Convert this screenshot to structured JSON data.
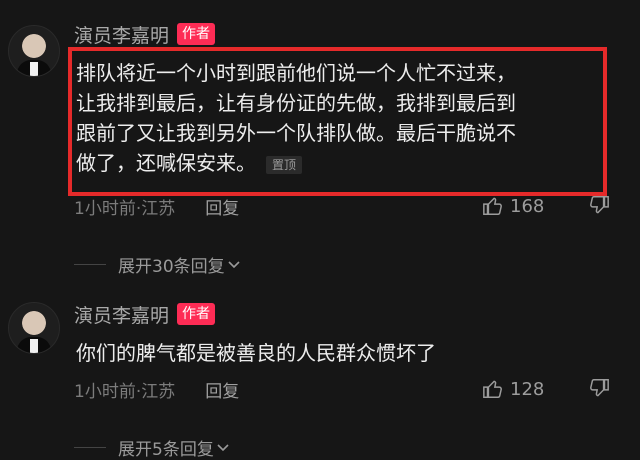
{
  "comments": [
    {
      "author": "演员李嘉明",
      "badge": "作者",
      "text_lines": [
        "排队将近一个小时到跟前他们说一个人忙不过来，",
        "让我排到最后，让有身份证的先做，我排到最后到",
        "跟前了又让我到另外一个队排队做。最后干脆说不",
        "做了，还喊保安来。"
      ],
      "pin_label": "置顶",
      "time": "1小时前·江苏",
      "reply_label": "回复",
      "likes": "168",
      "expand_label": "展开30条回复"
    },
    {
      "author": "演员李嘉明",
      "badge": "作者",
      "text_lines": [
        "你们的脾气都是被善良的人民群众惯坏了"
      ],
      "time": "1小时前·江苏",
      "reply_label": "回复",
      "likes": "128",
      "expand_label": "展开5条回复"
    }
  ],
  "colors": {
    "background": "#161616",
    "badge": "#fe2c55",
    "highlight_border": "#e52a2a"
  },
  "icons": [
    "avatar",
    "thumb-up-icon",
    "thumb-down-icon",
    "chevron-down-icon"
  ]
}
